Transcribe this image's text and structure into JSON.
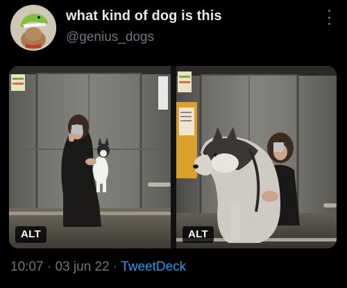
{
  "tweet": {
    "display_name": "what kind of dog is this",
    "handle": "@genius_dogs",
    "avatar_icon": "dog-in-dinosaur-costume",
    "more_icon": "more-vertical-icon"
  },
  "media": {
    "photos": [
      {
        "alt_label": "ALT",
        "description_icon": "elevator-selfie-woman-holding-small-husky-puppy"
      },
      {
        "alt_label": "ALT",
        "description_icon": "elevator-selfie-woman-hugging-large-husky"
      }
    ]
  },
  "footer": {
    "time": "10:07",
    "separator": "·",
    "date": "03 jun 22",
    "source": "TweetDeck"
  },
  "colors": {
    "background": "#000000",
    "primary_text": "#e7e9ea",
    "secondary_text": "#71767b",
    "link": "#1d9bf0"
  }
}
